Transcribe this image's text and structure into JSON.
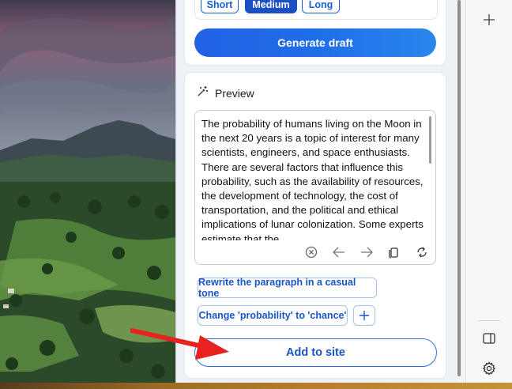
{
  "length": {
    "options": [
      "Short",
      "Medium",
      "Long"
    ],
    "selected": "Medium"
  },
  "generate_label": "Generate draft",
  "preview": {
    "title": "Preview",
    "text": "The probability of humans living on the Moon in the next 20 years is a topic of interest for many scientists, engineers, and space enthusiasts. There are several factors that influence this probability, such as the availability of resources, the development of technology, the cost of transportation, and the political and ethical implications of lunar colonization. Some experts estimate that the"
  },
  "suggestions": [
    "Rewrite the paragraph in a casual tone",
    "Change 'probability' to 'chance'"
  ],
  "add_label": "Add to site",
  "icons": {
    "sparkle_pen": "sparkle-pen-icon",
    "tools": [
      "clear-icon",
      "arrow-left-icon",
      "arrow-right-icon",
      "copy-icon",
      "refresh-icon"
    ],
    "sidebar": [
      "plus-icon",
      "split-panel-icon",
      "settings-icon"
    ]
  },
  "colors": {
    "accent": "#1d4fc4",
    "arrow": "#e8231f"
  }
}
